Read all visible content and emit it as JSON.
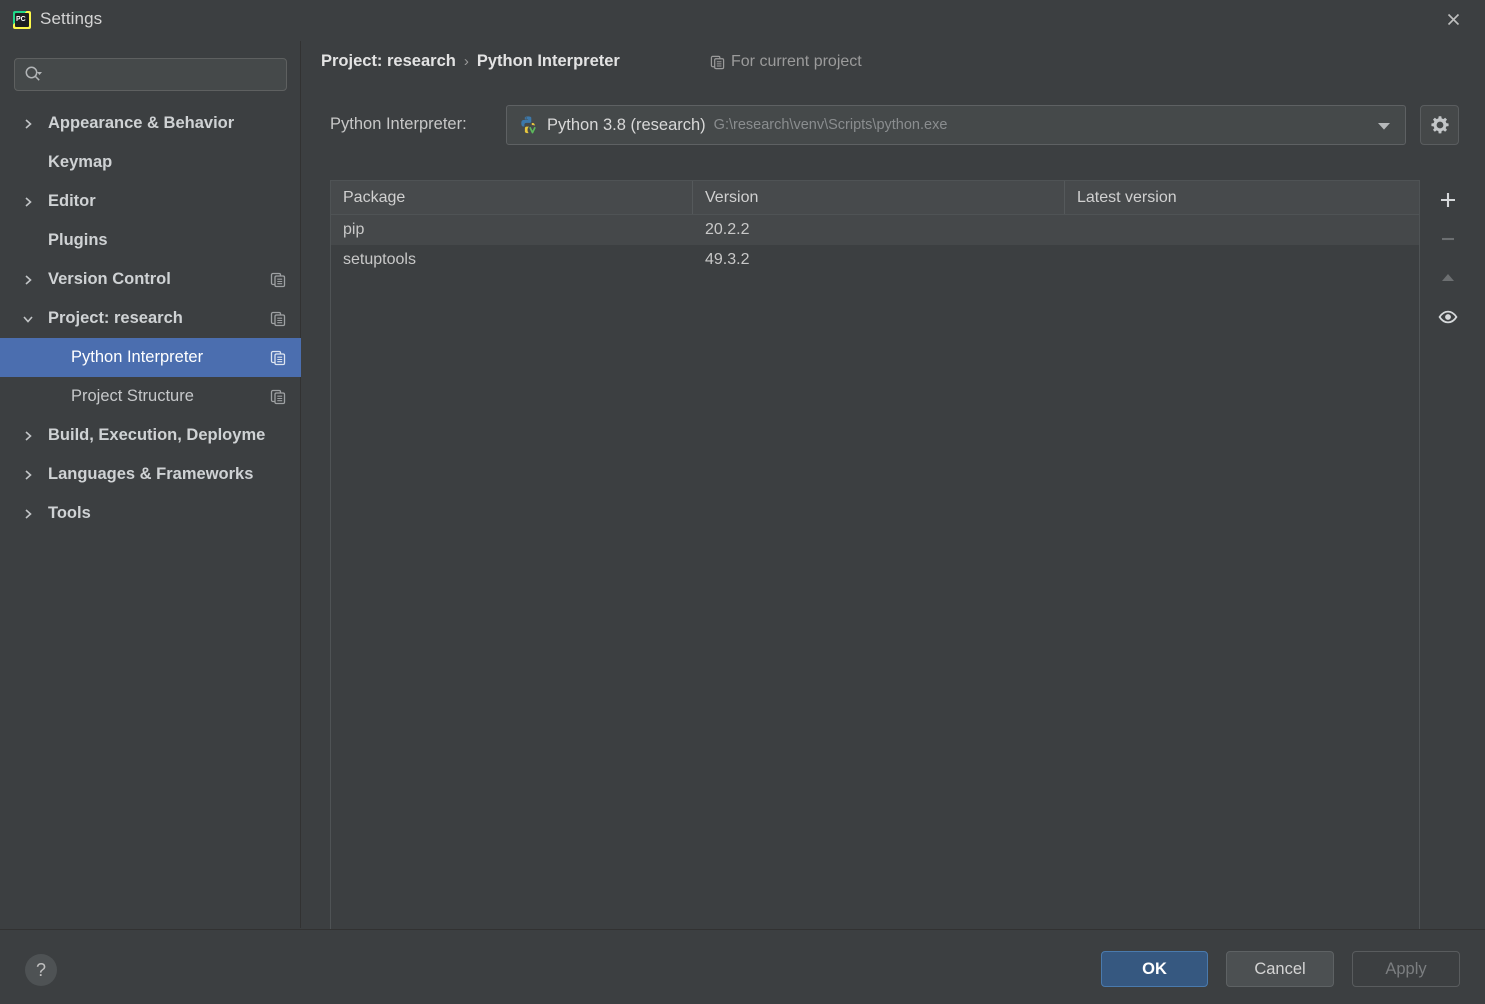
{
  "window": {
    "title": "Settings",
    "app_icon": "pycharm-icon",
    "close_icon": "close-icon"
  },
  "sidebar": {
    "search": {
      "placeholder": "",
      "value": "",
      "icon": "search-icon"
    },
    "items": [
      {
        "label": "Appearance & Behavior",
        "level": "top",
        "expandable": true,
        "expanded": false,
        "selected": false,
        "copy_icon": false
      },
      {
        "label": "Keymap",
        "level": "top",
        "expandable": false,
        "expanded": false,
        "selected": false,
        "copy_icon": false
      },
      {
        "label": "Editor",
        "level": "top",
        "expandable": true,
        "expanded": false,
        "selected": false,
        "copy_icon": false
      },
      {
        "label": "Plugins",
        "level": "top",
        "expandable": false,
        "expanded": false,
        "selected": false,
        "copy_icon": false
      },
      {
        "label": "Version Control",
        "level": "top",
        "expandable": true,
        "expanded": false,
        "selected": false,
        "copy_icon": true
      },
      {
        "label": "Project: research",
        "level": "top",
        "expandable": true,
        "expanded": true,
        "selected": false,
        "copy_icon": true
      },
      {
        "label": "Python Interpreter",
        "level": "child",
        "expandable": false,
        "expanded": false,
        "selected": true,
        "copy_icon": true
      },
      {
        "label": "Project Structure",
        "level": "child",
        "expandable": false,
        "expanded": false,
        "selected": false,
        "copy_icon": true
      },
      {
        "label": "Build, Execution, Deployme",
        "level": "top",
        "expandable": true,
        "expanded": false,
        "selected": false,
        "copy_icon": false
      },
      {
        "label": "Languages & Frameworks",
        "level": "top",
        "expandable": true,
        "expanded": false,
        "selected": false,
        "copy_icon": false
      },
      {
        "label": "Tools",
        "level": "top",
        "expandable": true,
        "expanded": false,
        "selected": false,
        "copy_icon": false
      }
    ]
  },
  "header": {
    "breadcrumb": [
      "Project: research",
      "Python Interpreter"
    ],
    "separator": "›",
    "for_current_project": "For current project",
    "for_current_project_icon": "copy-icon"
  },
  "interpreter": {
    "label": "Python Interpreter:",
    "icon": "python-venv-icon",
    "name": "Python 3.8 (research)",
    "path": "G:\\research\\venv\\Scripts\\python.exe",
    "dropdown_icon": "chevron-down-icon",
    "settings_icon": "gear-icon"
  },
  "packages": {
    "columns": [
      "Package",
      "Version",
      "Latest version"
    ],
    "rows": [
      {
        "package": "pip",
        "version": "20.2.2",
        "latest": ""
      },
      {
        "package": "setuptools",
        "version": "49.3.2",
        "latest": ""
      }
    ],
    "toolbar": [
      {
        "name": "add-package-button",
        "icon": "plus-icon",
        "enabled": true
      },
      {
        "name": "remove-package-button",
        "icon": "minus-icon",
        "enabled": false
      },
      {
        "name": "upgrade-package-button",
        "icon": "up-arrow-icon",
        "enabled": false
      },
      {
        "name": "show-early-releases-button",
        "icon": "eye-icon",
        "enabled": true
      }
    ]
  },
  "footer": {
    "help_label": "?",
    "help_icon": "help-icon",
    "ok_label": "OK",
    "cancel_label": "Cancel",
    "apply_label": "Apply"
  },
  "colors": {
    "background": "#3c3f41",
    "selection": "#4b6eaf",
    "ok_button": "#365880",
    "row_alt": "#45484a",
    "header_row": "#474a4c",
    "border": "#4f5355"
  }
}
